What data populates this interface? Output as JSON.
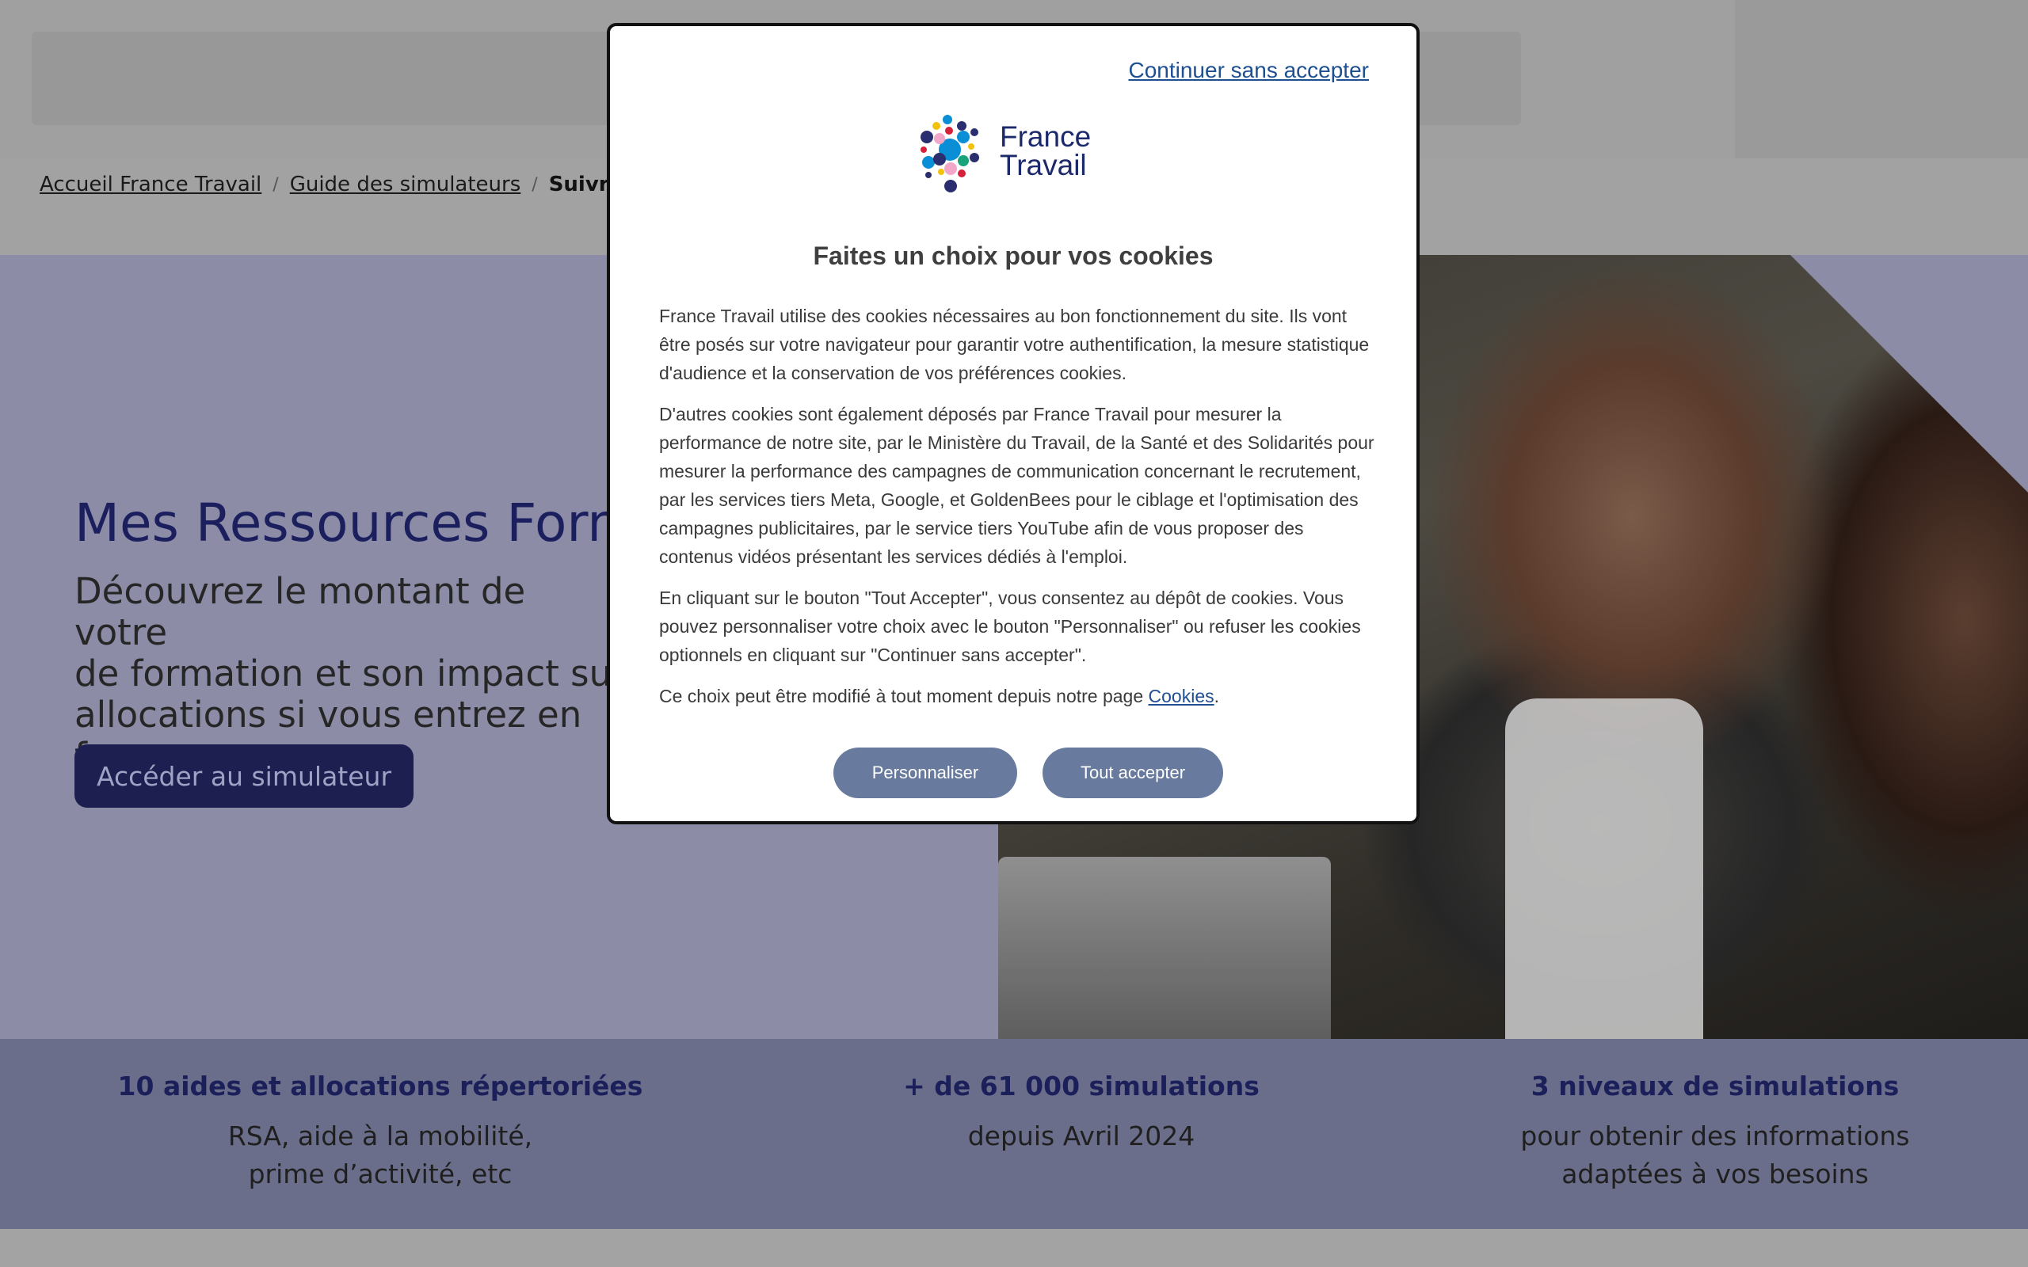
{
  "breadcrumb": {
    "items": [
      "Accueil France Travail",
      "Guide des simulateurs"
    ],
    "current": "Suivr",
    "separator": "/"
  },
  "hero": {
    "title": "Mes Ressources Forma",
    "subtitle_lines": [
      "Découvrez le montant de votre",
      "de formation et son impact sur",
      "allocations si vous entrez en for"
    ],
    "cta_label": "Accéder au simulateur"
  },
  "stats": [
    {
      "title": "10 aides et allocations répertoriées",
      "desc_lines": [
        "RSA, aide à la mobilité,",
        "prime d’activité, etc"
      ]
    },
    {
      "title": "+ de 61 000 simulations",
      "desc_lines": [
        "depuis Avril 2024"
      ]
    },
    {
      "title": "3 niveaux de simulations",
      "desc_lines": [
        "pour obtenir des informations",
        "adaptées à vos besoins"
      ]
    }
  ],
  "cookie_modal": {
    "skip_label": "Continuer sans accepter",
    "logo_line1": "France",
    "logo_line2": "Travail",
    "title": "Faites un choix pour vos cookies",
    "paragraph1": "France Travail utilise des cookies nécessaires au bon fonctionnement du site. Ils vont être posés sur votre navigateur pour garantir votre authentification, la mesure statistique d'audience et la conservation de vos préférences cookies.",
    "paragraph2": "D'autres cookies sont également déposés par France Travail pour mesurer la performance de notre site, par le Ministère du Travail, de la Santé et des Solidarités pour mesurer la performance des campagnes de communication concernant le recrutement, par les services tiers Meta, Google, et GoldenBees pour le ciblage et l'optimisation des campagnes publicitaires, par le service tiers YouTube afin de vous proposer des contenus vidéos présentant les services dédiés à l'emploi.",
    "paragraph3": "En cliquant sur le bouton \"Tout Accepter\", vous consentez au dépôt de cookies. Vous pouvez personnaliser votre choix avec le bouton \"Personnaliser\" ou refuser les cookies optionnels en cliquant sur \"Continuer sans accepter\".",
    "paragraph4_prefix": "Ce choix peut être modifié à tout moment depuis notre page",
    "paragraph4_link": "Cookies",
    "paragraph4_suffix": ".",
    "customize_label": "Personnaliser",
    "accept_label": "Tout accepter"
  },
  "colors": {
    "brand_navy": "#1c1f5e",
    "button_blue_gray": "#687b9e",
    "link_blue": "#1d4f91",
    "stats_band": "#6b6e8a"
  }
}
